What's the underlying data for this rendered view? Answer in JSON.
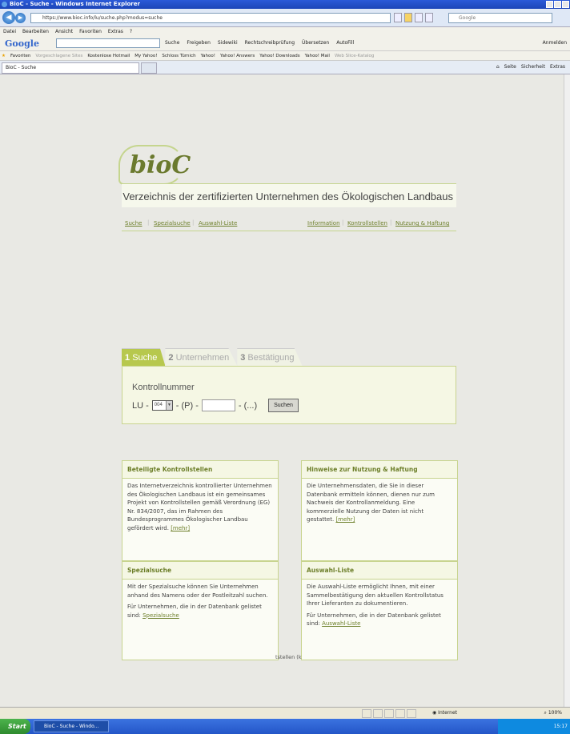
{
  "window": {
    "title": "BioC - Suche - Windows Internet Explorer",
    "url": "https://www.bioc.info/lu/suche.php?modus=suche",
    "search_placeholder": "Google"
  },
  "menu": [
    "Datei",
    "Bearbeiten",
    "Ansicht",
    "Favoriten",
    "Extras",
    "?"
  ],
  "google_toolbar": {
    "logo": "Google",
    "items": [
      "Suche",
      "Freigeben",
      "Sidewiki",
      "Rechtschreibprüfung",
      "Übersetzen",
      "AutoFill"
    ],
    "signin": "Anmelden"
  },
  "favorites": {
    "label": "Favoriten",
    "items": [
      "Vorgeschlagene Sites",
      "Kostenlose Hotmail",
      "My Yahoo!",
      "Schloss Türnich",
      "Yahoo!",
      "Yahoo! Answers",
      "Yahoo! Downloads",
      "Yahoo! Mail",
      "Web Slice-Katalog"
    ]
  },
  "tab": {
    "title": "BioC - Suche"
  },
  "command_bar": [
    "Seite",
    "Sicherheit",
    "Extras"
  ],
  "site": {
    "logo": "bioC",
    "title": "Verzeichnis der zertifizierten Unternehmen des Ökologischen Landbaus",
    "nav_left": [
      "Suche",
      "Spezialsuche",
      "Auswahl-Liste"
    ],
    "nav_right": [
      "Information",
      "Kontrollstellen",
      "Nutzung & Haftung"
    ]
  },
  "steps": [
    {
      "num": "1",
      "label": "Suche"
    },
    {
      "num": "2",
      "label": "Unternehmen"
    },
    {
      "num": "3",
      "label": "Bestätigung"
    }
  ],
  "search": {
    "label": "Kontrollnummer",
    "prefix": "LU -",
    "selected": "004",
    "mid": "- (P) -",
    "suffix": "- (...)",
    "button": "Suchen"
  },
  "boxes": {
    "kontrollstellen": {
      "title": "Beteiligte Kontrollstellen",
      "text": "Das Internetverzeichnis kontrollierter Unternehmen des Ökologischen Landbaus ist ein gemeinsames Projekt von Kontrollstellen gemäß Verordnung (EG) Nr. 834/2007, das im Rahmen des Bundesprogrammes Ökologischer Landbau gefördert wird.",
      "link": "[mehr]"
    },
    "hinweise": {
      "title": "Hinweise zur Nutzung & Haftung",
      "text": "Die Unternehmensdaten, die Sie in dieser Datenbank ermitteln können, dienen nur zum Nachweis der Kontrollanmeldung. Eine kommerzielle Nutzung der Daten ist nicht gestattet.",
      "link": "[mehr]"
    },
    "spezialsuche": {
      "title": "Spezialsuche",
      "text1": "Mit der Spezialsuche können Sie Unternehmen anhand des Namens oder der Postleitzahl suchen.",
      "text2": "Für Unternehmen, die in der Datenbank gelistet sind:",
      "link": "Spezialsuche"
    },
    "auswahl": {
      "title": "Auswahl-Liste",
      "text1": "Die Auswahl-Liste ermöglicht Ihnen, mit einer Sammelbestätigung den aktuellen Kontrollstatus Ihrer Lieferanten zu dokumentieren.",
      "text2": "Für Unternehmen, die in der Datenbank gelistet sind:",
      "link": "Auswahl-Liste"
    },
    "stray_text": "tstellen (k"
  },
  "status": {
    "zone": "Internet",
    "zoom": "100%"
  },
  "taskbar": {
    "start": "Start",
    "item": "BioC - Suche - Windo...",
    "time": "15:17"
  }
}
